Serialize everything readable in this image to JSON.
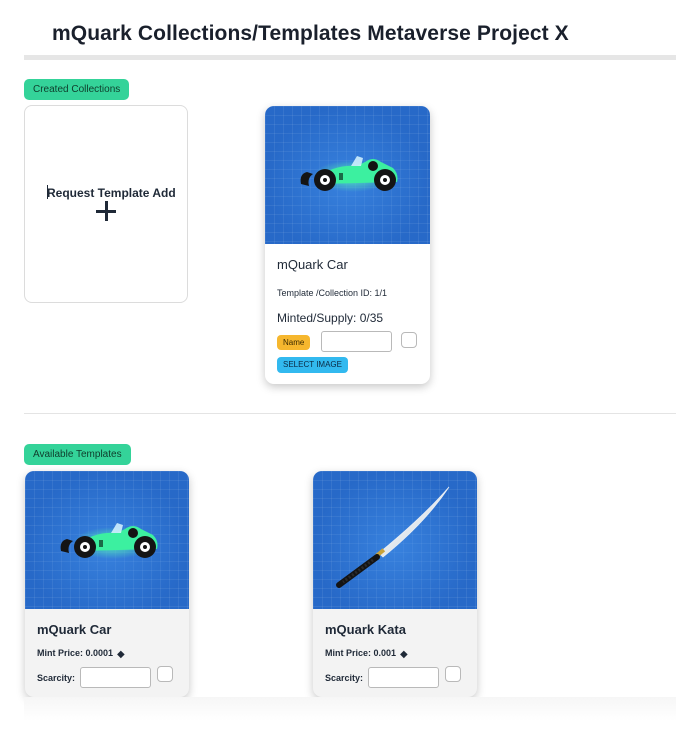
{
  "header": {
    "title": "mQuark Collections/Templates Metaverse Project X"
  },
  "created": {
    "badge": "Created Collections",
    "add_card": {
      "label": "Request Template Add",
      "icon": "plus-icon"
    },
    "collections": [
      {
        "name": "mQuark Car",
        "image": "racing-car-icon",
        "id_text": "Template /Collection ID: 1/1",
        "minted_text": "Minted/Supply: 0/35",
        "name_label": "Name",
        "name_value": "",
        "select_image_label": "SELECT IMAGE"
      }
    ]
  },
  "available": {
    "badge": "Available Templates",
    "templates": [
      {
        "name": "mQuark Car",
        "image": "racing-car-icon",
        "price_text": "Mint Price: 0.0001",
        "currency_icon": "ethereum-icon",
        "scarcity_label": "Scarcity:",
        "scarcity_value": ""
      },
      {
        "name": "mQuark Kata",
        "image": "katana-icon",
        "price_text": "Mint Price: 0.001",
        "currency_icon": "ethereum-icon",
        "scarcity_label": "Scarcity:",
        "scarcity_value": ""
      }
    ]
  },
  "colors": {
    "badge_green": "#34d399",
    "name_pill": "#f6b72e",
    "select_button": "#32b9ef",
    "image_bg": "#2769c8"
  }
}
